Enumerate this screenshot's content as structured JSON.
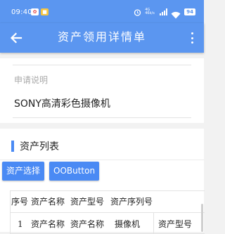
{
  "status_bar": {
    "time": "09:40",
    "network_label": "4G 46k/s",
    "battery": "94"
  },
  "toolbar": {
    "title": "资产领用详情单"
  },
  "description": {
    "label": "申请说明",
    "value": "SONY高清彩色摄像机"
  },
  "asset_list": {
    "title": "资产列表",
    "buttons": {
      "select": "资产选择",
      "oo": "OOButton"
    },
    "columns": [
      "序号",
      "资产名称",
      "资产型号",
      "资产序列号",
      ""
    ],
    "rows": [
      [
        "1",
        "资产名称",
        "资产名称",
        "摄像机",
        "资产型号"
      ]
    ]
  },
  "colors": {
    "primary": "#5b96f0",
    "button": "#4a8af4",
    "background": "#f2f2f2"
  }
}
